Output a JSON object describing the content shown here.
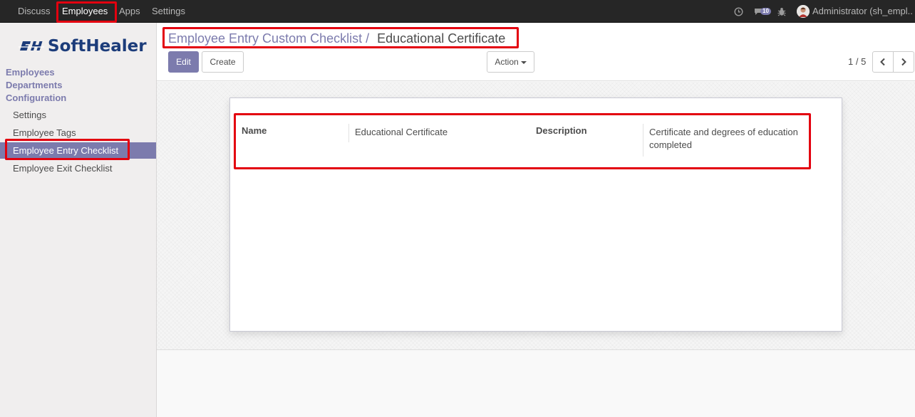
{
  "topbar": {
    "menu": [
      "Discuss",
      "Employees",
      "Apps",
      "Settings"
    ],
    "active_menu": "Employees",
    "messages_count": "10",
    "user": "Administrator (sh_empl..",
    "icons": [
      "clock-icon",
      "chat-icon",
      "bug-icon"
    ]
  },
  "sidebar": {
    "logo": "SoftHealer",
    "sections": [
      "Employees",
      "Departments",
      "Configuration"
    ],
    "config_items": [
      "Settings",
      "Employee Tags",
      "Employee Entry Checklist",
      "Employee Exit Checklist"
    ],
    "active_item": "Employee Entry Checklist"
  },
  "control_panel": {
    "breadcrumb_parent": "Employee Entry Custom Checklist",
    "breadcrumb_sep": "/",
    "breadcrumb_current": "Educational Certificate",
    "edit_label": "Edit",
    "create_label": "Create",
    "action_label": "Action",
    "pager": "1 / 5"
  },
  "form": {
    "name_label": "Name",
    "name_value": "Educational Certificate",
    "description_label": "Description",
    "description_value_line1": "Certificate and degrees of education",
    "description_value_line2": "completed"
  },
  "colors": {
    "accent": "#7c7bad",
    "navbar": "#262626",
    "highlight": "#e3000f"
  }
}
